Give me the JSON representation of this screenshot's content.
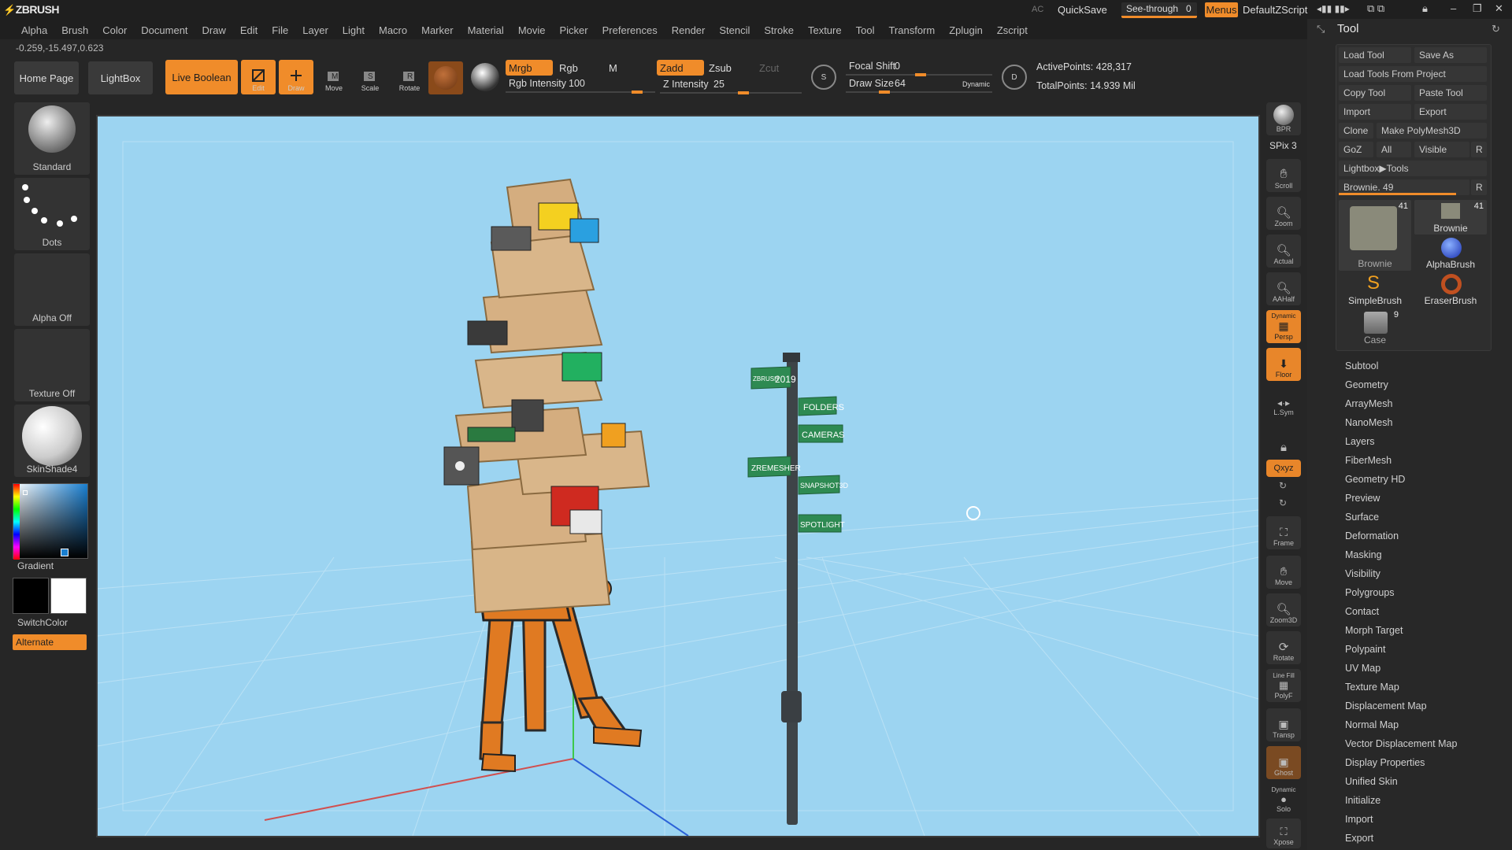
{
  "app": {
    "name": "ZBRUSH"
  },
  "title_right": {
    "ac": "AC",
    "quicksave": "QuickSave",
    "see_through_label": "See-through",
    "see_through_value": "0",
    "menus": "Menus",
    "script": "DefaultZScript"
  },
  "menu": [
    "Alpha",
    "Brush",
    "Color",
    "Document",
    "Draw",
    "Edit",
    "File",
    "Layer",
    "Light",
    "Macro",
    "Marker",
    "Material",
    "Movie",
    "Picker",
    "Preferences",
    "Render",
    "Stencil",
    "Stroke",
    "Texture",
    "Tool",
    "Transform",
    "Zplugin",
    "Zscript"
  ],
  "coords": "-0.259,-15.497,0.623",
  "toolbar": {
    "home": "Home Page",
    "lightbox": "LightBox",
    "live_boolean": "Live Boolean",
    "edit": "Edit",
    "draw": "Draw",
    "move": "Move",
    "scale": "Scale",
    "rotate": "Rotate",
    "mrgb": "Mrgb",
    "rgb": "Rgb",
    "m": "M",
    "rgb_intensity_label": "Rgb Intensity",
    "rgb_intensity": "100",
    "rgb_intensity_frac": 1.0,
    "zadd": "Zadd",
    "zsub": "Zsub",
    "zcut": "Zcut",
    "z_intensity_label": "Z Intensity",
    "z_intensity": "25",
    "z_intensity_frac": 0.25,
    "focal_shift_label": "Focal Shift",
    "focal_shift": "0",
    "draw_size_label": "Draw Size",
    "draw_size": "64",
    "dynamic": "Dynamic",
    "active_points_label": "ActivePoints:",
    "active_points": "428,317",
    "total_points_label": "TotalPoints:",
    "total_points": "14.939 Mil"
  },
  "left": {
    "brush": "Standard",
    "stroke": "Dots",
    "alpha": "Alpha Off",
    "texture": "Texture Off",
    "material": "SkinShade4",
    "gradient": "Gradient",
    "switch_color": "SwitchColor",
    "alternate": "Alternate"
  },
  "right_shelf": {
    "bpr": "BPR",
    "spix_label": "SPix",
    "spix": "3",
    "scroll": "Scroll",
    "zoom": "Zoom",
    "actual": "Actual",
    "aahalf": "AAHalf",
    "dynamic": "Dynamic",
    "persp": "Persp",
    "floor": "Floor",
    "lsym": "L.Sym",
    "xyz": "Qxyz",
    "frame": "Frame",
    "move": "Move",
    "zoom3d": "Zoom3D",
    "rotate": "Rotate",
    "line_fill": "Line Fill",
    "polyf": "PolyF",
    "transp": "Transp",
    "ghost": "Ghost",
    "dynamic2": "Dynamic",
    "solo": "Solo",
    "xpose": "Xpose"
  },
  "tool_panel": {
    "title": "Tool",
    "load_tool": "Load Tool",
    "save_as": "Save As",
    "load_from_project": "Load Tools From Project",
    "copy_tool": "Copy Tool",
    "paste_tool": "Paste Tool",
    "import": "Import",
    "export": "Export",
    "clone": "Clone",
    "make_polymesh": "Make PolyMesh3D",
    "goz": "GoZ",
    "all": "All",
    "visible": "Visible",
    "r": "R",
    "lightbox_tools": "Lightbox▶Tools",
    "current_label": "Brownie.",
    "current_value": "49",
    "current_frac": 0.9,
    "thumbs": [
      {
        "name": "Brownie",
        "count": "41"
      },
      {
        "name": "Brownie",
        "count": "41"
      },
      {
        "name": "AlphaBrush",
        "count": ""
      },
      {
        "name": "SimpleBrush",
        "count": ""
      },
      {
        "name": "EraserBrush",
        "count": ""
      },
      {
        "name": "Case",
        "count": "9"
      }
    ],
    "subpalettes": [
      "Subtool",
      "Geometry",
      "ArrayMesh",
      "NanoMesh",
      "Layers",
      "FiberMesh",
      "Geometry HD",
      "Preview",
      "Surface",
      "Deformation",
      "Masking",
      "Visibility",
      "Polygroups",
      "Contact",
      "Morph Target",
      "Polypaint",
      "UV Map",
      "Texture Map",
      "Displacement Map",
      "Normal Map",
      "Vector Displacement Map",
      "Display Properties",
      "Unified Skin",
      "Initialize",
      "Import",
      "Export"
    ]
  },
  "signpost": {
    "year": "2019",
    "brand": "ZBRUSH",
    "folders": "FOLDERS",
    "cameras": "CAMERAS",
    "zremesher": "ZREMESHER",
    "snapshot": "SNAPSHOT3D",
    "spotlight": "SPOTLIGHT"
  },
  "colors": {
    "accent": "#f08c2a",
    "viewport": "#9cd4f1",
    "sign_green": "#2e8a52"
  }
}
